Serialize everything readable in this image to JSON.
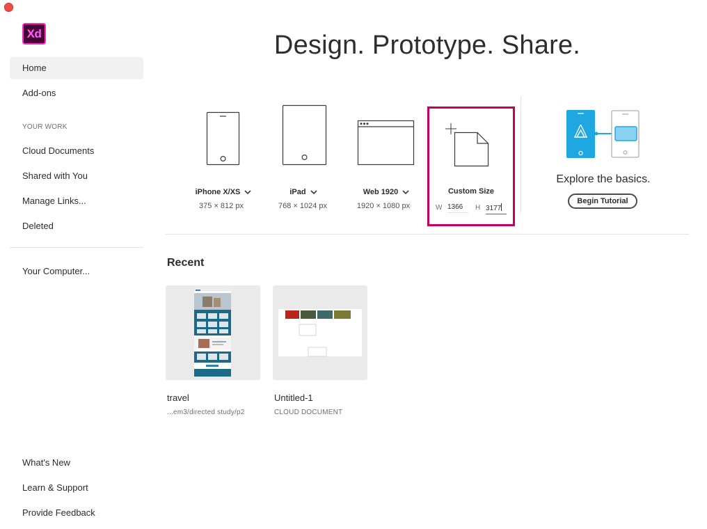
{
  "app": {
    "logo_text": "Xd",
    "brand_color": "#ff61f6",
    "logo_bg": "#470137"
  },
  "sidebar": {
    "top_items": [
      {
        "label": "Home",
        "active": true
      },
      {
        "label": "Add-ons",
        "active": false
      }
    ],
    "section_label": "YOUR WORK",
    "work_items": [
      {
        "label": "Cloud Documents"
      },
      {
        "label": "Shared with You"
      },
      {
        "label": "Manage Links..."
      },
      {
        "label": "Deleted"
      }
    ],
    "computer_item": {
      "label": "Your Computer..."
    },
    "bottom_items": [
      {
        "label": "What's New"
      },
      {
        "label": "Learn & Support"
      },
      {
        "label": "Provide Feedback"
      }
    ]
  },
  "main": {
    "headline": "Design. Prototype. Share.",
    "presets": [
      {
        "name": "iPhone X/XS",
        "dims": "375 × 812 px",
        "icon": "phone-icon"
      },
      {
        "name": "iPad",
        "dims": "768 × 1024 px",
        "icon": "tablet-icon"
      },
      {
        "name": "Web 1920",
        "dims": "1920 × 1080 px",
        "icon": "browser-window-icon"
      }
    ],
    "custom_size": {
      "name": "Custom Size",
      "width_label": "W",
      "width_value": "1366",
      "height_label": "H",
      "height_value": "3177",
      "highlight_color": "#c7005d"
    },
    "tutorial": {
      "text": "Explore the basics.",
      "button_label": "Begin Tutorial",
      "accent_color": "#1ea7e1"
    },
    "recent": {
      "title": "Recent",
      "items": [
        {
          "name": "travel",
          "subtitle": "...em3/directed study/p2"
        },
        {
          "name": "Untitled-1",
          "subtitle": "CLOUD DOCUMENT"
        }
      ]
    }
  }
}
